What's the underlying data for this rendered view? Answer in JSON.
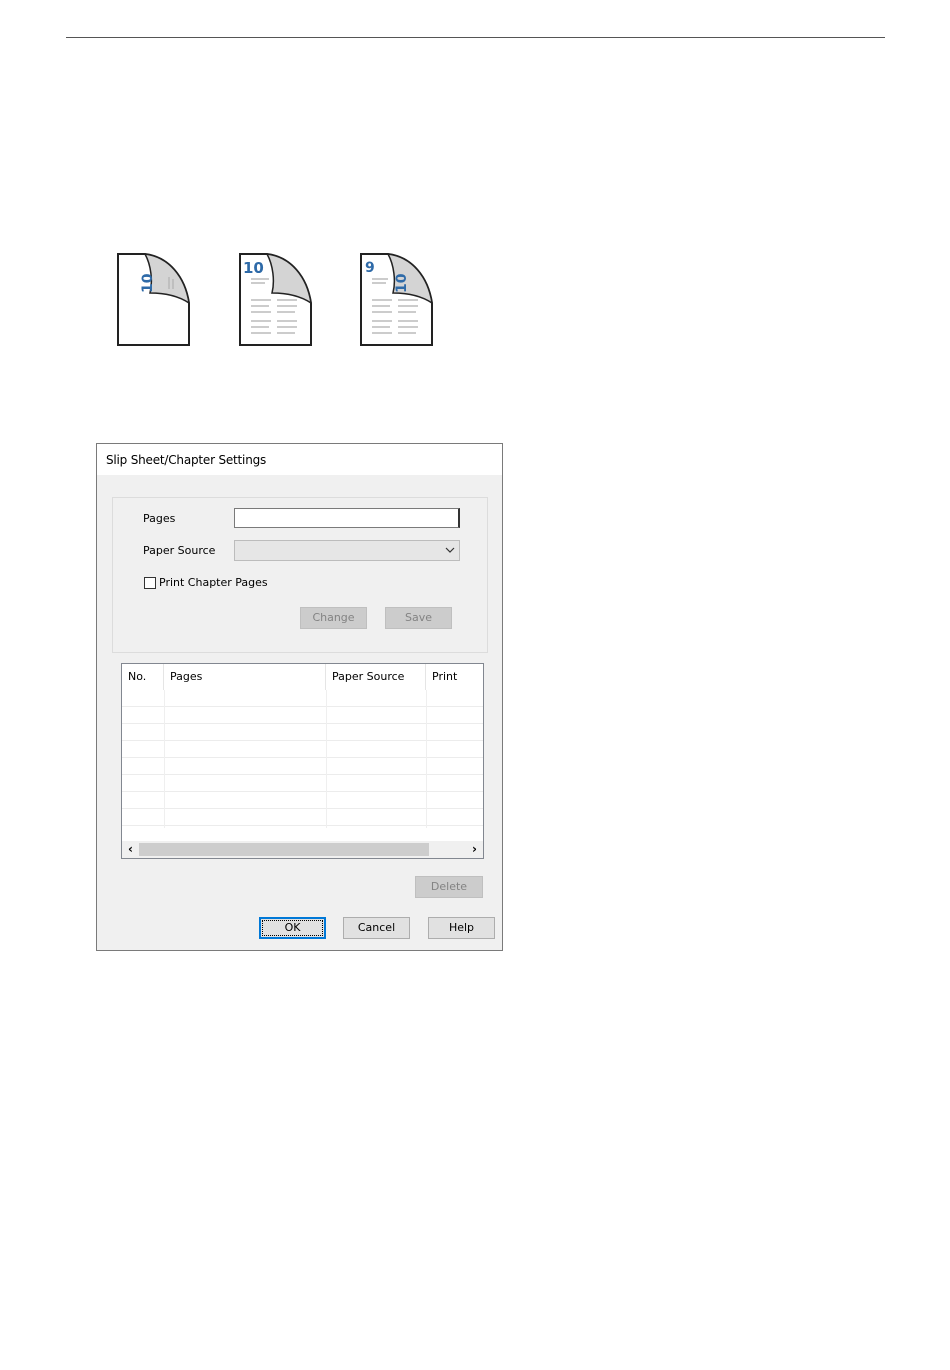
{
  "illustrations": [
    {
      "back_number": "10"
    },
    {
      "front_number": "10"
    },
    {
      "front_number": "9",
      "back_number": "10"
    }
  ],
  "dialog": {
    "title": "Slip Sheet/Chapter Settings",
    "pages_label": "Pages",
    "pages_value": "",
    "paper_source_label": "Paper Source",
    "paper_source_value": "",
    "print_chapter_label": "Print Chapter Pages",
    "print_chapter_checked": false,
    "change_label": "Change",
    "save_label": "Save",
    "table": {
      "columns": [
        "No.",
        "Pages",
        "Paper Source",
        "Print"
      ],
      "rows": []
    },
    "delete_label": "Delete",
    "ok_label": "OK",
    "cancel_label": "Cancel",
    "help_label": "Help"
  },
  "colors": {
    "accent": "#0078d7",
    "page_number": "#2e6aa8",
    "dialog_bg": "#f0f0f0"
  }
}
